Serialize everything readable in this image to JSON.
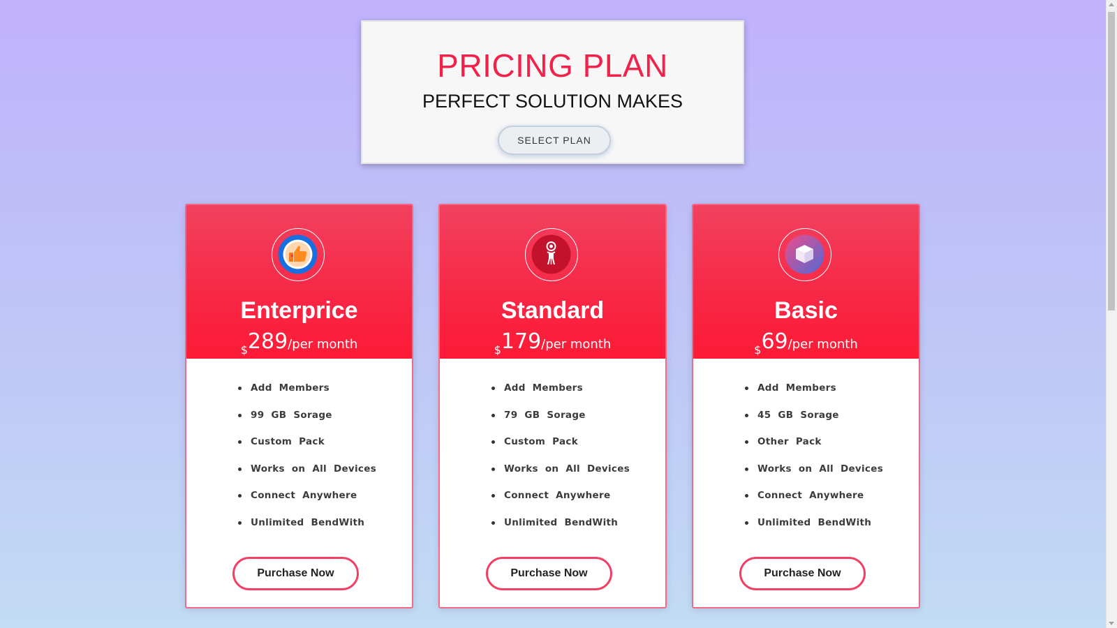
{
  "hero": {
    "title": "PRICING PLAN",
    "subtitle": "PERFECT SOLUTION MAKES",
    "select_label": "SELECT PLAN"
  },
  "colors": {
    "accent": "#f0214a",
    "card_header": "#f82543",
    "card_border": "#f46a86"
  },
  "plans": [
    {
      "name": "Enterprice",
      "currency": "$",
      "price": "289",
      "period": "/per month",
      "icon": "thumbs-up-icon",
      "features": [
        "Add Members",
        "99 GB Sorage",
        "Custom Pack",
        "Works on All Devices",
        "Connect Anywhere",
        "Unlimited BendWith"
      ],
      "button_label": "Purchase Now"
    },
    {
      "name": "Standard",
      "currency": "$",
      "price": "179",
      "period": "/per month",
      "icon": "astronaut-icon",
      "features": [
        "Add Members",
        "79 GB Sorage",
        "Custom Pack",
        "Works on All Devices",
        "Connect Anywhere",
        "Unlimited BendWith"
      ],
      "button_label": "Purchase Now"
    },
    {
      "name": "Basic",
      "currency": "$",
      "price": "69",
      "period": "/per month",
      "icon": "cube-icon",
      "features": [
        "Add Members",
        "45 GB Sorage",
        "Other Pack",
        "Works on All Devices",
        "Connect Anywhere",
        "Unlimited BendWith"
      ],
      "button_label": "Purchase Now"
    }
  ]
}
